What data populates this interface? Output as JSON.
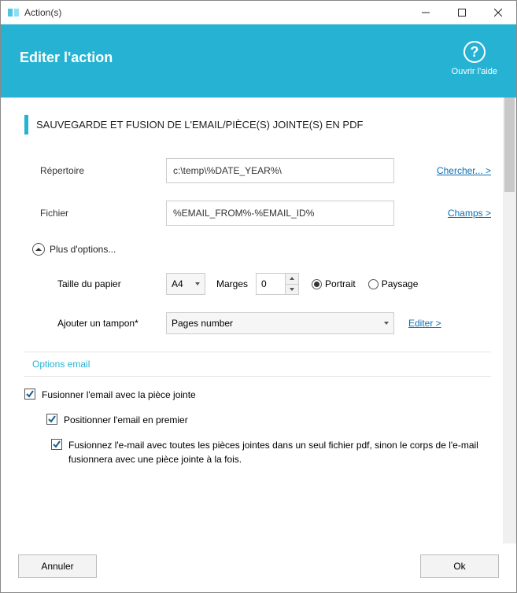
{
  "window": {
    "title": "Action(s)"
  },
  "header": {
    "title": "Editer l'action",
    "help": "Ouvrir l'aide"
  },
  "action": {
    "title": "SAUVEGARDE ET FUSION DE L'EMAIL/PIÈCE(S) JOINTE(S) EN PDF"
  },
  "labels": {
    "directory": "Répertoire",
    "file": "Fichier",
    "browse": "Chercher...  >",
    "fields": "Champs  >",
    "more": "Plus d'options...",
    "paper": "Taille du papier",
    "margins": "Marges",
    "portrait": "Portrait",
    "landscape": "Paysage",
    "stamp": "Ajouter un tampon*",
    "edit": "Editer  >"
  },
  "values": {
    "directory": "c:\\temp\\%DATE_YEAR%\\",
    "file": "%EMAIL_FROM%-%EMAIL_ID%",
    "paper": "A4",
    "margins": "0",
    "stamp": "Pages number"
  },
  "email": {
    "heading": "Options email",
    "merge": "Fusionner l'email avec la pièce jointe",
    "first": "Positionner l'email en premier",
    "single": "Fusionnez l'e-mail avec toutes les pièces jointes dans un seul fichier pdf, sinon le corps de l'e-mail fusionnera avec une pièce jointe à la fois."
  },
  "footer": {
    "cancel": "Annuler",
    "ok": "Ok"
  }
}
